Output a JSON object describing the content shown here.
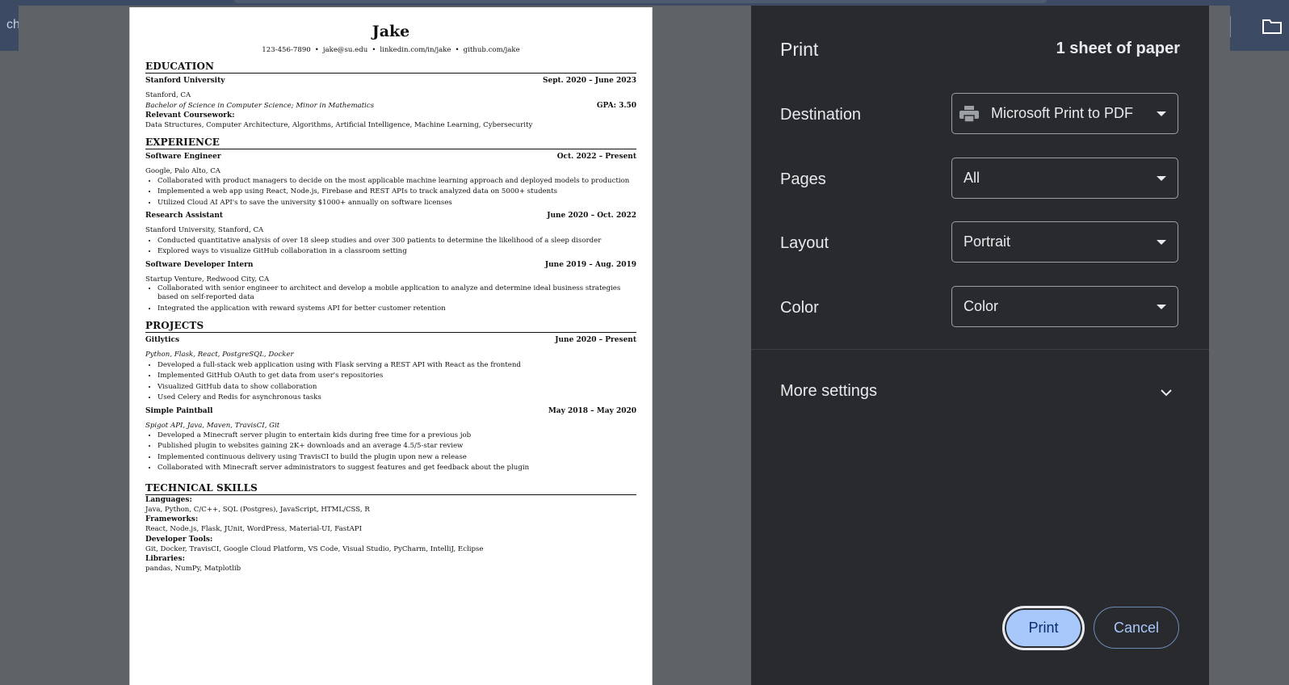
{
  "background": {
    "tab_text": "ch",
    "folder_icon": "folder-icon"
  },
  "resume": {
    "name": "Jake",
    "contact": [
      "123-456-7890",
      "jake@su.edu",
      "linkedin.com/in/jake",
      "github.com/jake"
    ],
    "contact_separator": "•",
    "education": {
      "heading": "EDUCATION",
      "school": "Stanford University",
      "dates": "Sept. 2020 – June 2023",
      "location": "Stanford, CA",
      "degree": "Bachelor of Science in Computer Science; Minor in Mathematics",
      "gpa": "GPA: 3.50",
      "coursework_label": "Relevant Coursework:",
      "coursework": "Data Structures, Computer Architecture, Algorithms, Artificial Intelligence, Machine Learning, Cybersecurity"
    },
    "experience": {
      "heading": "EXPERIENCE",
      "jobs": [
        {
          "title": "Software Engineer",
          "dates": "Oct. 2022 – Present",
          "org": "Google, Palo Alto, CA",
          "bullets": [
            "Collaborated with product managers to decide on the most applicable machine learning approach and deployed models to production",
            "Implemented a web app using React, Node.js, Firebase and REST APIs to track analyzed data on 5000+ students",
            "Utilized Cloud AI API's to save the university $1000+ annually on software licenses"
          ]
        },
        {
          "title": "Research Assistant",
          "dates": "June 2020 – Oct. 2022",
          "org": "Stanford University, Stanford, CA",
          "bullets": [
            "Conducted quantitative analysis of over 18 sleep studies and over 300 patients to determine the likelihood of a sleep disorder",
            "Explored ways to visualize GitHub collaboration in a classroom setting"
          ]
        },
        {
          "title": "Software Developer Intern",
          "dates": "June 2019 – Aug. 2019",
          "org": "Startup Venture, Redwood City, CA",
          "bullets": [
            "Collaborated with senior engineer to architect and develop a mobile application to analyze and determine ideal business strategies based on self-reported data",
            "Integrated the application with reward systems API for better customer retention"
          ]
        }
      ]
    },
    "projects": {
      "heading": "PROJECTS",
      "items": [
        {
          "name": "Gitlytics",
          "dates": "June 2020 – Present",
          "tech": "Python, Flask, React, PostgreSQL, Docker",
          "bullets": [
            "Developed a full-stack web application using with Flask serving a REST API with React as the frontend",
            "Implemented GitHub OAuth to get data from user's repositories",
            "Visualized GitHub data to show collaboration",
            "Used Celery and Redis for asynchronous tasks"
          ]
        },
        {
          "name": "Simple Paintball",
          "dates": "May 2018 – May 2020",
          "tech": "Spigot API, Java, Maven, TravisCI, Git",
          "bullets": [
            "Developed a Minecraft server plugin to entertain kids during free time for a previous job",
            "Published plugin to websites gaining 2K+ downloads and an average 4.5/5-star review",
            "Implemented continuous delivery using TravisCI to build the plugin upon new a release",
            "Collaborated with Minecraft server administrators to suggest features and get feedback about the plugin"
          ]
        }
      ]
    },
    "skills": {
      "heading": "TECHNICAL SKILLS",
      "groups": [
        {
          "label": "Languages:",
          "value": "Java, Python, C/C++, SQL (Postgres), JavaScript, HTML/CSS, R"
        },
        {
          "label": "Frameworks:",
          "value": "React, Node.js, Flask, JUnit, WordPress, Material-UI, FastAPI"
        },
        {
          "label": "Developer Tools:",
          "value": "Git, Docker, TravisCI, Google Cloud Platform, VS Code, Visual Studio, PyCharm, IntelliJ, Eclipse"
        },
        {
          "label": "Libraries:",
          "value": "pandas, NumPy, Matplotlib"
        }
      ]
    }
  },
  "print_panel": {
    "title": "Print",
    "sheets": "1 sheet of paper",
    "destination": {
      "label": "Destination",
      "value": "Microsoft Print to PDF",
      "icon": "printer-icon"
    },
    "pages": {
      "label": "Pages",
      "value": "All"
    },
    "layout": {
      "label": "Layout",
      "value": "Portrait"
    },
    "color": {
      "label": "Color",
      "value": "Color"
    },
    "more_settings": "More settings",
    "print_button": "Print",
    "cancel_button": "Cancel"
  },
  "colors": {
    "panel_bg": "#292a2d",
    "primary_button": "#a8c7fa",
    "backdrop": "#5f6368"
  }
}
